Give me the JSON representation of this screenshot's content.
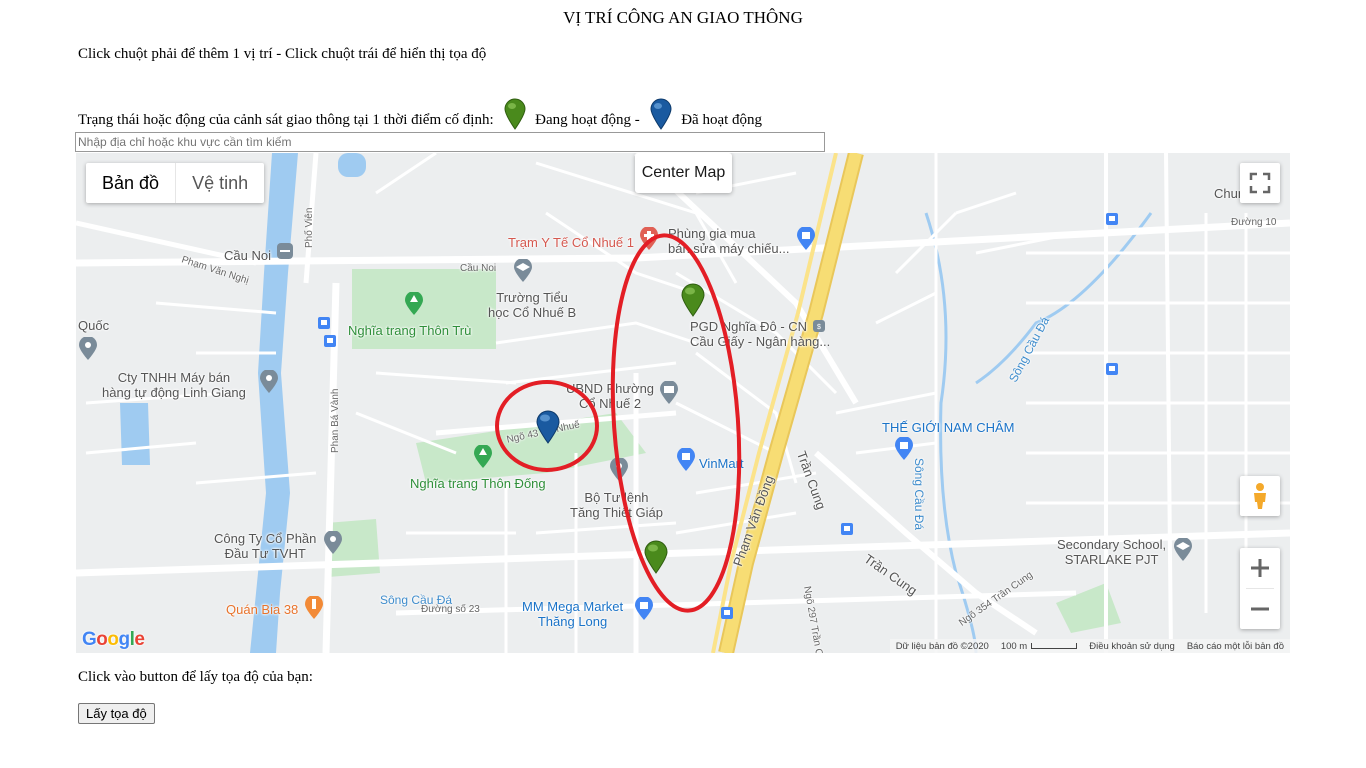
{
  "page": {
    "title": "VỊ TRÍ CÔNG AN GIAO THÔNG",
    "instruction": "Click chuột phải để thêm 1 vị trí - Click chuột trái để hiển thị tọa độ",
    "status_prefix": "Trạng thái hoặc động của cảnh sát giao thông tại 1 thời điểm cố định:",
    "status_active": "Đang hoạt động -",
    "status_done": "Đã hoạt động",
    "search_placeholder": "Nhập địa chỉ hoặc khu vực cần tìm kiếm",
    "get_coords_label": "Click vào button để lấy tọa độ của bạn:",
    "get_coords_button": "Lấy tọa độ"
  },
  "map": {
    "maptype_map": "Bản đồ",
    "maptype_satellite": "Vệ tinh",
    "center_map": "Center Map",
    "google_logo": "Google",
    "attribution": {
      "data": "Dữ liệu bản đồ ©2020",
      "scale": "100 m",
      "terms": "Điều khoản sử dụng",
      "report": "Báo cáo một lỗi bản đồ"
    },
    "labels": {
      "cau_noi": "Cầu Noi",
      "cau_noi_road": "Cầu Noi",
      "pham_van_nghi": "Phạm Văn Nghị",
      "pho_vien": "Phố Viên",
      "quoc": "Quốc",
      "tram_yte": "Trạm Y Tế Cổ Nhuế 1",
      "phung_gia": "Phùng gia mua\nbán sửa máy chiếu...",
      "truong_tieu_hoc": "Trường Tiểu\nhọc Cổ Nhuế B",
      "nghia_trang_thon_tru": "Nghĩa trang Thôn Trù",
      "pgd": "PGD Nghĩa Đô - CN\nCầu Giấy - Ngân hàng...",
      "cty_tnhh": "Cty TNHH Máy bán\nhàng tự động Linh Giang",
      "ubnd": "UBND Phường\nCổ Nhuế 2",
      "ngo_43": "Ngõ 43 Cổ Nhuế",
      "phan_ba_vanh": "Phan Bá Vành",
      "vinmart": "VinMart",
      "the_gioi_nam_cham": "THẾ GIỚI NAM CHÂM",
      "song_cau_da_1": "Sông Cầu Đá",
      "nghia_trang_thon_dong": "Nghĩa trang Thôn Đống",
      "bo_tu_lenh": "Bộ Tư lệnh\nTăng Thiết Giáp",
      "tran_cung_1": "Trần Cung",
      "song_cau_da_2": "Sông Cầu Đá",
      "pham_van_dong": "Phạm Văn Đồng",
      "cong_ty_co_phan": "Công Ty Cổ Phần\nĐầu Tư TVHT",
      "secondary_school": "Secondary School,\nSTARLAKE PJT",
      "tran_cung_2": "Trần Cung",
      "quan_bia": "Quán Bia 38",
      "song_cau_da_3": "Sông Cầu Đá",
      "duong_so_23": "Đường số 23",
      "mm_mega": "MM Mega Market\nThăng Long",
      "ngo_297": "Ngõ 297 Trần Cung",
      "ngo_354": "Ngõ 354 Trần Cung",
      "chung": "Chung",
      "duong_10": "Đường 10"
    }
  },
  "markers": [
    {
      "name": "active-marker-1",
      "status": "Đang hoạt động",
      "color": "#4a8a1c"
    },
    {
      "name": "active-marker-2",
      "status": "Đang hoạt động",
      "color": "#4a8a1c"
    },
    {
      "name": "done-marker-1",
      "status": "Đã hoạt động",
      "color": "#1a5aa0"
    }
  ],
  "colors": {
    "active_marker": "#4a8a1c",
    "done_marker": "#1a5aa0",
    "annotation_circle": "#e31e25",
    "highway": "#f5d96b",
    "water": "#9fcbf1",
    "park": "#c3e7c7"
  }
}
